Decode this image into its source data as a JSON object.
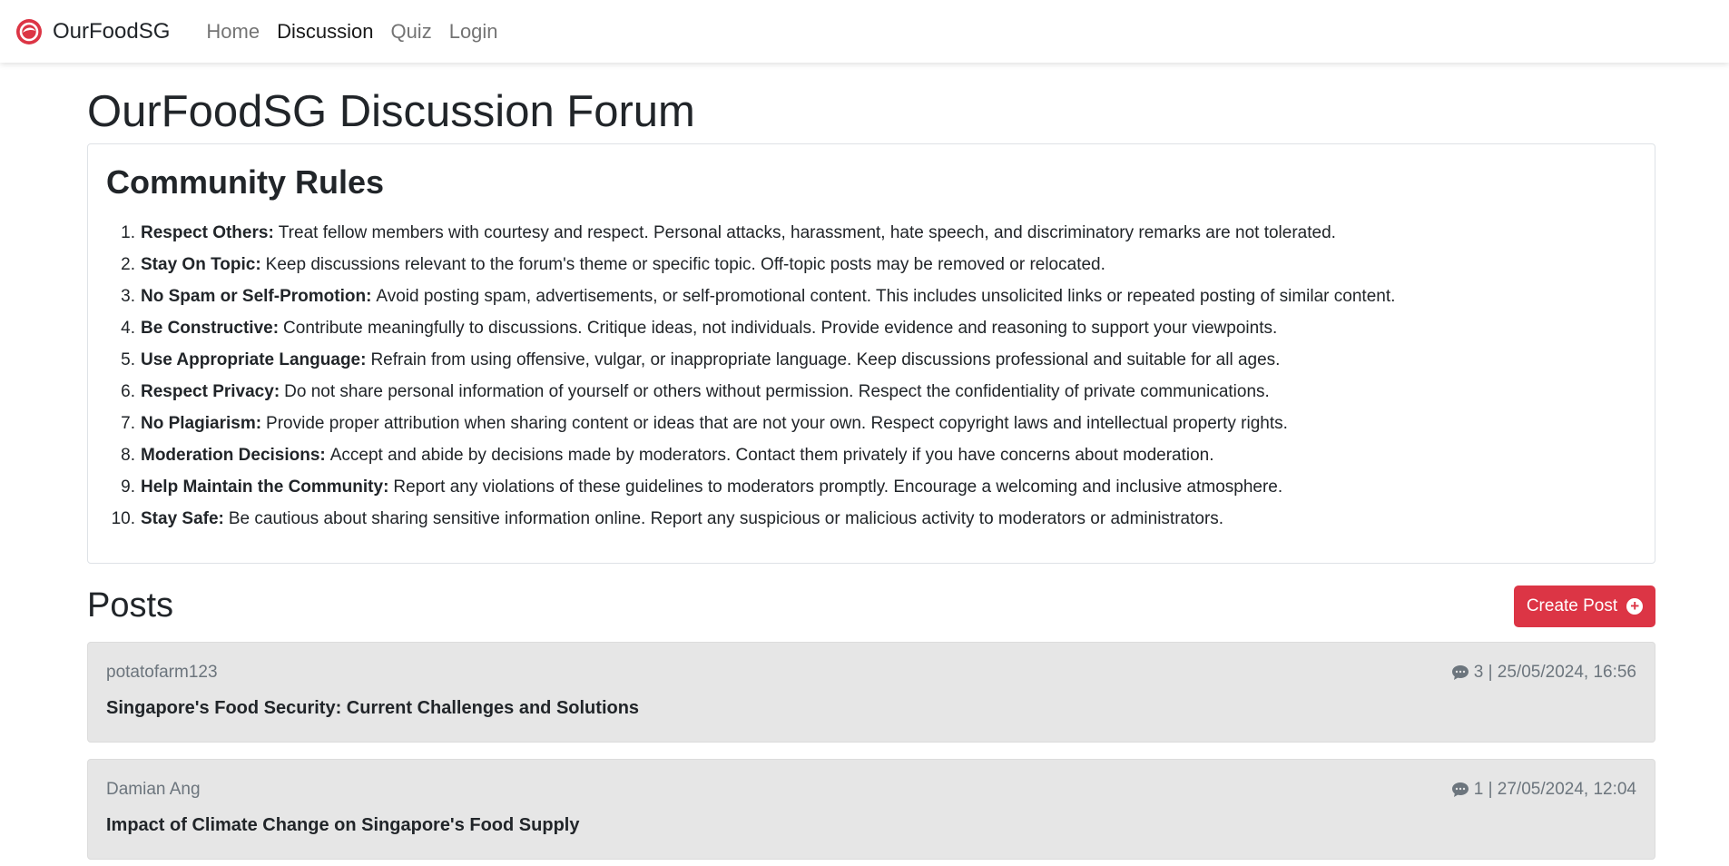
{
  "nav": {
    "brand": "OurFoodSG",
    "links": [
      {
        "label": "Home",
        "active": false
      },
      {
        "label": "Discussion",
        "active": true
      },
      {
        "label": "Quiz",
        "active": false
      },
      {
        "label": "Login",
        "active": false
      }
    ]
  },
  "page": {
    "title": "OurFoodSG Discussion Forum"
  },
  "rules": {
    "title": "Community Rules",
    "items": [
      {
        "num": "1.",
        "name": "Respect Others:",
        "text": "Treat fellow members with courtesy and respect. Personal attacks, harassment, hate speech, and discriminatory remarks are not tolerated."
      },
      {
        "num": "2.",
        "name": "Stay On Topic:",
        "text": "Keep discussions relevant to the forum's theme or specific topic. Off-topic posts may be removed or relocated."
      },
      {
        "num": "3.",
        "name": "No Spam or Self-Promotion:",
        "text": "Avoid posting spam, advertisements, or self-promotional content. This includes unsolicited links or repeated posting of similar content."
      },
      {
        "num": "4.",
        "name": "Be Constructive:",
        "text": "Contribute meaningfully to discussions. Critique ideas, not individuals. Provide evidence and reasoning to support your viewpoints."
      },
      {
        "num": "5.",
        "name": "Use Appropriate Language:",
        "text": "Refrain from using offensive, vulgar, or inappropriate language. Keep discussions professional and suitable for all ages."
      },
      {
        "num": "6.",
        "name": "Respect Privacy:",
        "text": "Do not share personal information of yourself or others without permission. Respect the confidentiality of private communications."
      },
      {
        "num": "7.",
        "name": "No Plagiarism:",
        "text": "Provide proper attribution when sharing content or ideas that are not your own. Respect copyright laws and intellectual property rights."
      },
      {
        "num": "8.",
        "name": "Moderation Decisions:",
        "text": "Accept and abide by decisions made by moderators. Contact them privately if you have concerns about moderation."
      },
      {
        "num": "9.",
        "name": "Help Maintain the Community:",
        "text": "Report any violations of these guidelines to moderators promptly. Encourage a welcoming and inclusive atmosphere."
      },
      {
        "num": "10.",
        "name": "Stay Safe:",
        "text": "Be cautious about sharing sensitive information online. Report any suspicious or malicious activity to moderators or administrators."
      }
    ]
  },
  "posts": {
    "title": "Posts",
    "create_label": "Create Post",
    "items": [
      {
        "author": "potatofarm123",
        "comments": "3",
        "datetime": "25/05/2024, 16:56",
        "title": "Singapore's Food Security: Current Challenges and Solutions"
      },
      {
        "author": "Damian Ang",
        "comments": "1",
        "datetime": "27/05/2024, 12:04",
        "title": "Impact of Climate Change on Singapore's Food Supply"
      }
    ]
  },
  "colors": {
    "accent": "#dc3545",
    "post_bg": "#e6e6e6",
    "muted": "#6c757d"
  },
  "icons": {
    "brand": "ourfoodsg-logo-icon",
    "comment": "comment-bubble-icon",
    "plus": "plus-circle-icon"
  }
}
